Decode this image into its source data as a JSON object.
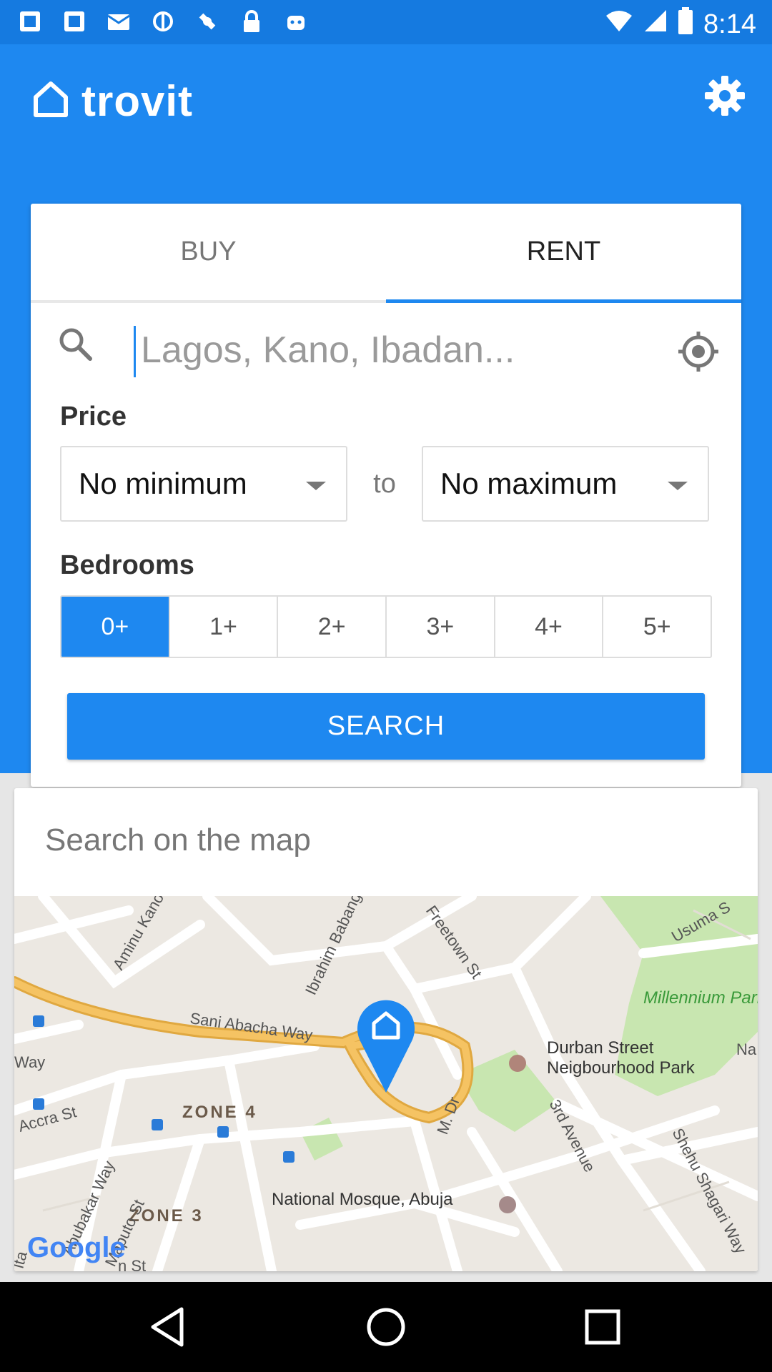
{
  "status": {
    "time": "8:14"
  },
  "app": {
    "name": "trovit"
  },
  "tabs": [
    {
      "label": "BUY",
      "active": false
    },
    {
      "label": "RENT",
      "active": true
    }
  ],
  "search": {
    "placeholder": "Lagos, Kano, Ibadan...",
    "value": ""
  },
  "price": {
    "label": "Price",
    "min": "No minimum",
    "to": "to",
    "max": "No maximum"
  },
  "bedrooms": {
    "label": "Bedrooms",
    "options": [
      "0+",
      "1+",
      "2+",
      "3+",
      "4+",
      "5+"
    ],
    "selected": "0+"
  },
  "search_button": "SEARCH",
  "map_section": {
    "title": "Search on the map",
    "labels": {
      "road_sani_abacha": "Sani Abacha Way",
      "road_ibrahim": "Ibrahim Babangida",
      "road_freetown": "Freetown St",
      "road_aminu_kano": "Aminu Kano",
      "road_usuma": "Usuma S",
      "park_millennium": "Millennium Park",
      "park_durban_1": "Durban Street",
      "park_durban_2": "Neigbourhood Park",
      "road_3rd_avenue": "3rd Avenue",
      "road_shehu": "Shehu Shagari Way",
      "zone_4": "ZONE 4",
      "zone_3": "ZONE 3",
      "mosque": "National Mosque, Abuja",
      "road_accra": "Accra St",
      "road_maputo": "Maputo St",
      "road_abubakar": "Abubakar Way",
      "road_way": "Way",
      "road_m_dr": "M. Dr",
      "road_na": "Na",
      "road_lta": "lta",
      "road_n_st": "n St",
      "google": "Google"
    }
  },
  "colors": {
    "primary": "#1e88f0",
    "status_bar": "#157ae0",
    "road_major": "#f5c363",
    "park": "#c8e6b0"
  }
}
